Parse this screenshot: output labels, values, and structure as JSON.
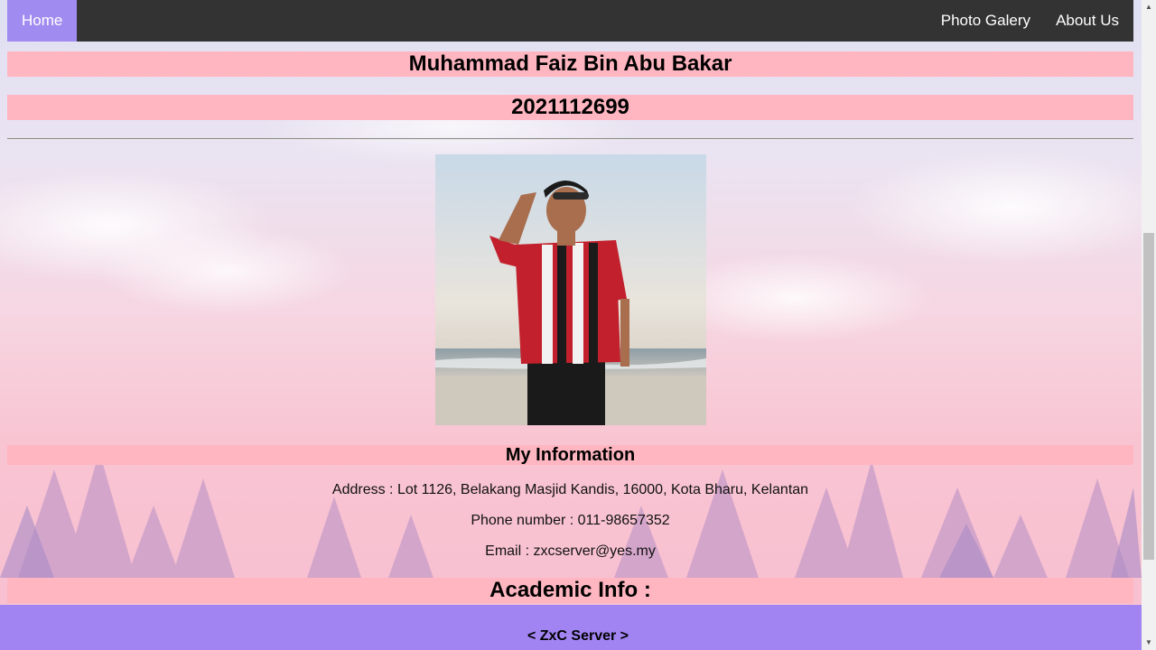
{
  "nav": {
    "home_label": "Home",
    "gallery_label": "Photo Galery",
    "about_label": "About Us",
    "active": "Home"
  },
  "profile": {
    "name": "Muhammad Faiz Bin Abu Bakar",
    "student_id": "2021112699"
  },
  "info": {
    "heading": "My Information",
    "address": "Address : Lot 1126, Belakang Masjid Kandis, 16000, Kota Bharu, Kelantan",
    "phone": "Phone number : 011-98657352",
    "email": "Email : zxcserver@yes.my"
  },
  "academic": {
    "heading": "Academic Info :"
  },
  "footer": {
    "text": "< ZxC Server >"
  },
  "colors": {
    "nav_bg": "#333333",
    "nav_active": "#a08cf0",
    "bar_pink": "#ffb6c1",
    "footer_purple": "#a184f2"
  },
  "icons": {
    "scroll_up": "scroll-up-arrow-icon",
    "scroll_down": "scroll-down-arrow-icon"
  }
}
